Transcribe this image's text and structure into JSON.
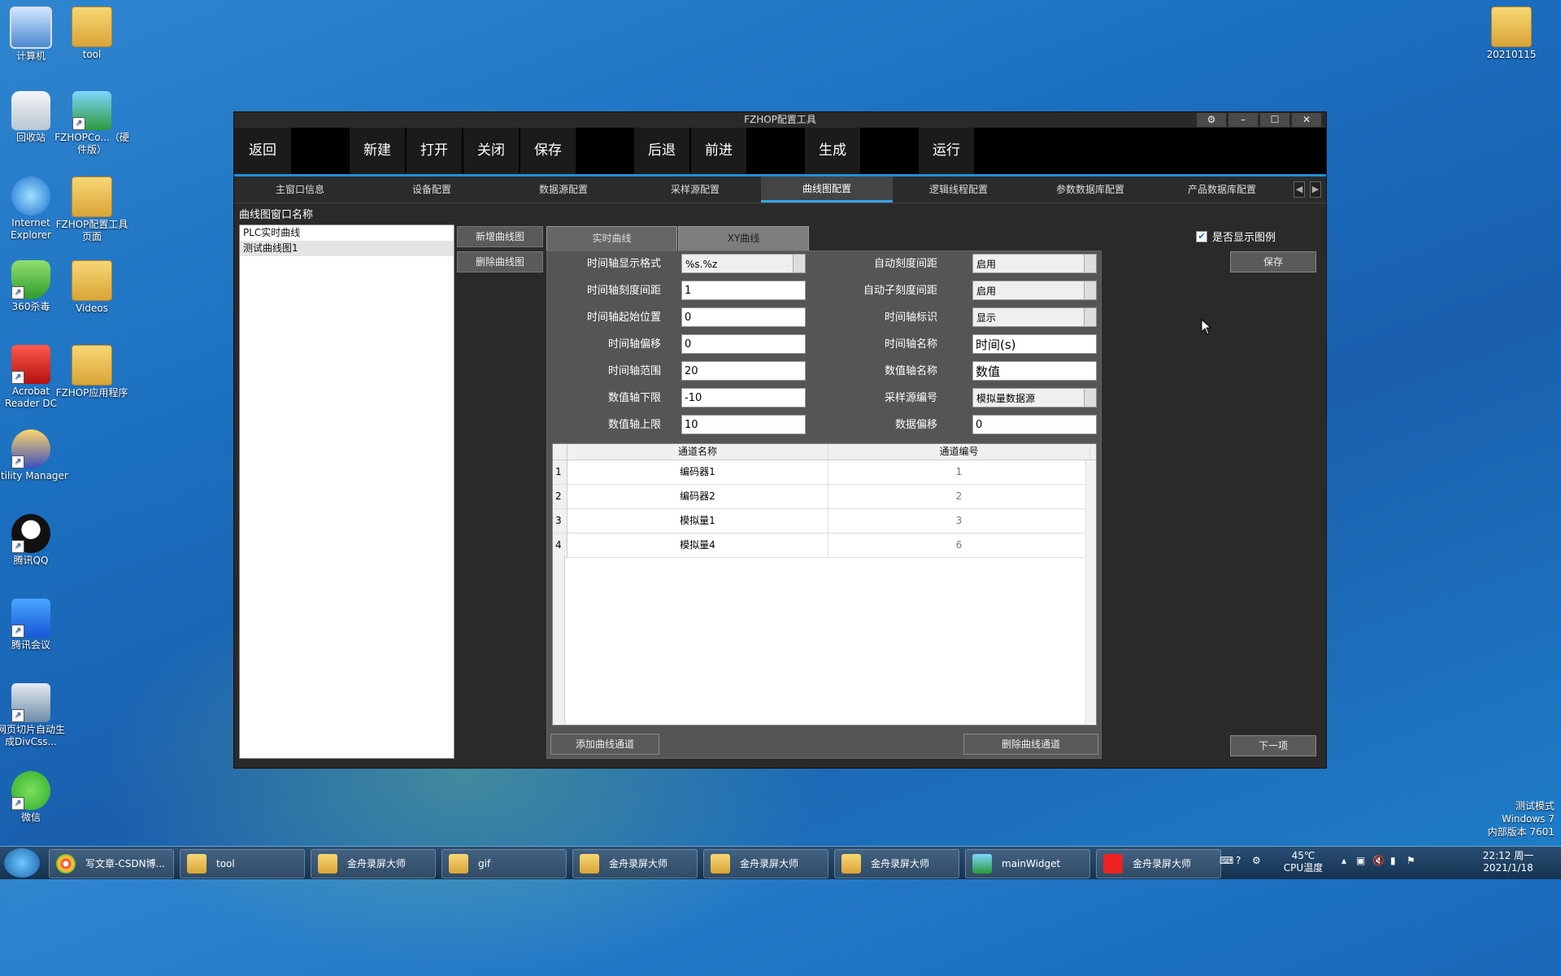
{
  "desktop_icons": [
    {
      "label": "计算机",
      "icon": "computer-icon"
    },
    {
      "label": "tool",
      "icon": "folder-icon"
    },
    {
      "label": "回收站",
      "icon": "recycle-bin-icon"
    },
    {
      "label": "FZHOPCo...（硬件版）",
      "icon": "app-icon"
    },
    {
      "label": "Internet Explorer",
      "icon": "ie-icon"
    },
    {
      "label": "FZHOP配置工具页面",
      "icon": "folder-icon"
    },
    {
      "label": "360杀毒",
      "icon": "shield-icon"
    },
    {
      "label": "Videos",
      "icon": "folder-icon"
    },
    {
      "label": "Acrobat Reader DC",
      "icon": "acrobat-icon"
    },
    {
      "label": "FZHOP应用程序",
      "icon": "folder-icon"
    },
    {
      "label": "Utility Manager",
      "icon": "utility-icon"
    },
    {
      "label": "腾讯QQ",
      "icon": "qq-icon"
    },
    {
      "label": "腾讯会议",
      "icon": "meeting-icon"
    },
    {
      "label": "网页切片自动生成DivCss...",
      "icon": "web-tool-icon"
    },
    {
      "label": "微信",
      "icon": "wechat-icon"
    },
    {
      "label": "20210115",
      "icon": "folder-icon"
    }
  ],
  "window": {
    "title": "FZHOP配置工具",
    "controls": [
      "⚙",
      "–",
      "☐",
      "✕"
    ]
  },
  "toolbar": {
    "back": "返回",
    "new": "新建",
    "open": "打开",
    "close": "关闭",
    "save": "保存",
    "undo": "后退",
    "redo": "前进",
    "generate": "生成",
    "run": "运行"
  },
  "tabs": [
    "主窗口信息",
    "设备配置",
    "数据源配置",
    "采样源配置",
    "曲线图配置",
    "逻辑线程配置",
    "参数数据库配置",
    "产品数据库配置"
  ],
  "active_tab": "曲线图配置",
  "curve_window_label": "曲线图窗口名称",
  "curve_list": [
    "PLC实时曲线",
    "测试曲线图1"
  ],
  "side_buttons": {
    "add": "新增曲线图",
    "delete": "删除曲线图"
  },
  "subtabs": [
    "实时曲线",
    "XY曲线"
  ],
  "left_fields": [
    {
      "label": "时间轴显示格式",
      "value": "%s.%z",
      "type": "select"
    },
    {
      "label": "时间轴刻度间距",
      "value": "1",
      "type": "input"
    },
    {
      "label": "时间轴起始位置",
      "value": "0",
      "type": "input"
    },
    {
      "label": "时间轴偏移",
      "value": "0",
      "type": "input"
    },
    {
      "label": "时间轴范围",
      "value": "20",
      "type": "input"
    },
    {
      "label": "数值轴下限",
      "value": "-10",
      "type": "input"
    },
    {
      "label": "数值轴上限",
      "value": "10",
      "type": "input"
    }
  ],
  "right_fields": [
    {
      "label": "自动刻度间距",
      "value": "启用",
      "type": "select"
    },
    {
      "label": "自动子刻度间距",
      "value": "启用",
      "type": "select"
    },
    {
      "label": "时间轴标识",
      "value": "显示",
      "type": "select"
    },
    {
      "label": "时间轴名称",
      "value": "时间(s)",
      "type": "input"
    },
    {
      "label": "数值轴名称",
      "value": "数值",
      "type": "input"
    },
    {
      "label": "采样源编号",
      "value": "模拟量数据源",
      "type": "select"
    },
    {
      "label": "数据偏移",
      "value": "0",
      "type": "input"
    }
  ],
  "channel_table": {
    "headers": [
      "通道名称",
      "通道编号"
    ],
    "rows": [
      {
        "index": "1",
        "name": "编码器1",
        "id": "1"
      },
      {
        "index": "2",
        "name": "编码器2",
        "id": "2"
      },
      {
        "index": "3",
        "name": "模拟量1",
        "id": "3"
      },
      {
        "index": "4",
        "name": "模拟量4",
        "id": "6"
      }
    ]
  },
  "panel_buttons": {
    "add_channel": "添加曲线通道",
    "delete_channel": "删除曲线通道"
  },
  "show_legend": {
    "label": "是否显示图例",
    "checked": true
  },
  "right_buttons": {
    "save": "保存",
    "next": "下一项"
  },
  "watermark": [
    "测试模式",
    "Windows 7",
    "内部版本 7601"
  ],
  "taskbar": {
    "tasks": [
      {
        "label": "写文章-CSDN博...",
        "icon": "chrome-icon"
      },
      {
        "label": "tool",
        "icon": "folder-icon"
      },
      {
        "label": "金舟录屏大师",
        "icon": "folder-icon"
      },
      {
        "label": "gif",
        "icon": "folder-icon"
      },
      {
        "label": "金舟录屏大师",
        "icon": "folder-icon"
      },
      {
        "label": "金舟录屏大师",
        "icon": "folder-icon"
      },
      {
        "label": "金舟录屏大师",
        "icon": "folder-icon"
      },
      {
        "label": "mainWidget",
        "icon": "app-icon"
      },
      {
        "label": "金舟录屏大师",
        "icon": "recorder-icon"
      }
    ],
    "cpu_temp": "45℃",
    "cpu_label": "CPU温度",
    "time": "22:12 周一",
    "date": "2021/1/18"
  },
  "colors": {
    "accent": "#1e8fd6",
    "window_bg": "#2a2a2a",
    "panel_bg": "#555555"
  }
}
